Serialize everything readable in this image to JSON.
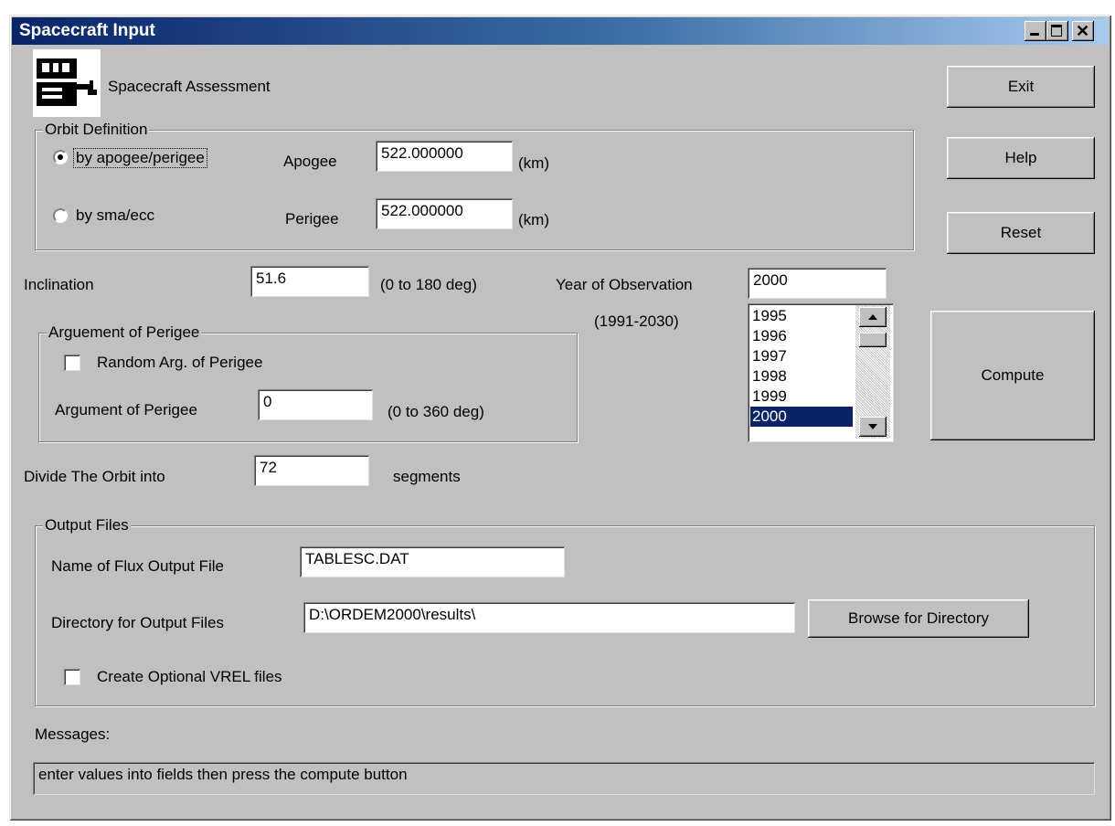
{
  "window": {
    "title": "Spacecraft Input"
  },
  "title_buttons": {
    "minimize": "minimize-icon",
    "maximize": "maximize-icon",
    "close": "close-icon"
  },
  "header": {
    "app_label": "Spacecraft Assessment",
    "icon": "spacecraft-app-icon"
  },
  "buttons": {
    "exit": "Exit",
    "help": "Help",
    "reset": "Reset",
    "compute": "Compute",
    "browse": "Browse for Directory"
  },
  "orbit": {
    "group_title": "Orbit Definition",
    "radio_apogee_perigee": "by apogee/perigee",
    "radio_sma_ecc": "by sma/ecc",
    "selected": "by apogee/perigee",
    "apogee_label": "Apogee",
    "apogee_value": "522.000000",
    "apogee_unit": "(km)",
    "perigee_label": "Perigee",
    "perigee_value": "522.000000",
    "perigee_unit": "(km)"
  },
  "inclination": {
    "label": "Inclination",
    "value": "51.6",
    "range": "(0 to 180 deg)"
  },
  "year": {
    "label": "Year of Observation",
    "value": "2000",
    "range": "(1991-2030)",
    "list": [
      "1995",
      "1996",
      "1997",
      "1998",
      "1999",
      "2000"
    ],
    "selected": "2000"
  },
  "perigee_arg": {
    "group_title": "Arguement of Perigee",
    "random_label": "Random Arg. of Perigee",
    "random_checked": false,
    "label": "Argument of Perigee",
    "value": "0",
    "range": "(0 to 360 deg)"
  },
  "segments": {
    "label": "Divide The Orbit into",
    "value": "72",
    "unit": "segments"
  },
  "output": {
    "group_title": "Output Files",
    "flux_label": "Name of Flux Output File",
    "flux_value": "TABLESC.DAT",
    "dir_label": "Directory for Output Files",
    "dir_value": "D:\\ORDEM2000\\results\\",
    "vrel_label": "Create Optional VREL files",
    "vrel_checked": false
  },
  "messages": {
    "label": "Messages:",
    "text": "enter values into fields then press the compute button"
  }
}
